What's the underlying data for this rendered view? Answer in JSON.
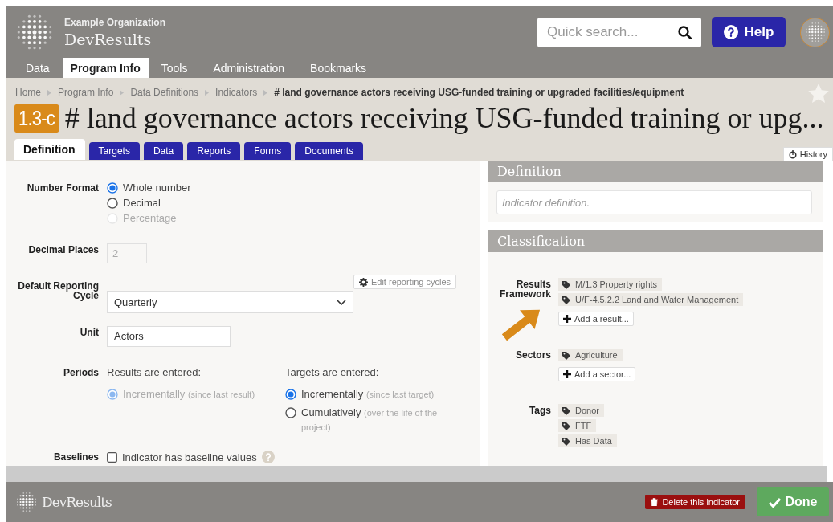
{
  "header": {
    "organization": "Example Organization",
    "app_name": "DevResults",
    "search": {
      "placeholder": "Quick search..."
    },
    "help_button": "Help"
  },
  "nav": [
    {
      "label": "Data",
      "selected": false
    },
    {
      "label": "Program Info",
      "selected": true
    },
    {
      "label": "Tools",
      "selected": false
    },
    {
      "label": "Administration",
      "selected": false
    },
    {
      "label": "Bookmarks",
      "selected": false
    }
  ],
  "breadcrumb": [
    "Home",
    "Program Info",
    "Data Definitions",
    "Indicators"
  ],
  "breadcrumb_current": "# land governance actors receiving USG-funded training or upgraded facilities/equipment",
  "indicator": {
    "code": "1.3-c",
    "title": "# land governance actors receiving USG-funded training or upg...",
    "favorite": false
  },
  "tabs": [
    {
      "label": "Definition",
      "selected": true
    },
    {
      "label": "Targets",
      "selected": false
    },
    {
      "label": "Data",
      "selected": false
    },
    {
      "label": "Reports",
      "selected": false
    },
    {
      "label": "Forms",
      "selected": false
    },
    {
      "label": "Documents",
      "selected": false
    }
  ],
  "history_button": "History",
  "form": {
    "number_format": {
      "label": "Number Format",
      "options": [
        {
          "label": "Whole number",
          "selected": true,
          "disabled": false
        },
        {
          "label": "Decimal",
          "selected": false,
          "disabled": false
        },
        {
          "label": "Percentage",
          "selected": false,
          "disabled": true
        }
      ]
    },
    "decimal_places": {
      "label": "Decimal Places",
      "value": "2",
      "disabled": true
    },
    "reporting_cycle": {
      "label": "Default Reporting Cycle",
      "value": "Quarterly",
      "edit_button": "Edit reporting cycles"
    },
    "unit": {
      "label": "Unit",
      "value": "Actors"
    },
    "periods": {
      "label": "Periods",
      "groups": [
        {
          "heading": "Results are entered:",
          "options": [
            {
              "label": "Incrementally",
              "note": "(since last result)",
              "selected": true,
              "disabled": true
            }
          ]
        },
        {
          "heading": "Targets are entered:",
          "options": [
            {
              "label": "Incrementally",
              "note": "(since last target)",
              "selected": true,
              "disabled": false
            },
            {
              "label": "Cumulatively",
              "note": "(over the life of the project)",
              "selected": false,
              "disabled": false
            }
          ]
        }
      ]
    },
    "baselines": {
      "label": "Baselines",
      "option": "Indicator has baseline values",
      "checked": false
    }
  },
  "definition": {
    "title": "Definition",
    "placeholder": "Indicator definition."
  },
  "classification": {
    "title": "Classification",
    "groups": [
      {
        "label": "Results Framework",
        "tags": [
          "M/1.3 Property rights",
          "U/F-4.5.2.2 Land and Water Management"
        ],
        "add_button": "Add a result..."
      },
      {
        "label": "Sectors",
        "tags": [
          "Agriculture"
        ],
        "add_button": "Add a sector..."
      },
      {
        "label": "Tags",
        "tags": [
          "Donor",
          "FTF",
          "Has Data"
        ]
      }
    ]
  },
  "footer": {
    "brand": "DevResults",
    "delete_button": "Delete this indicator",
    "done_button": "Done"
  }
}
